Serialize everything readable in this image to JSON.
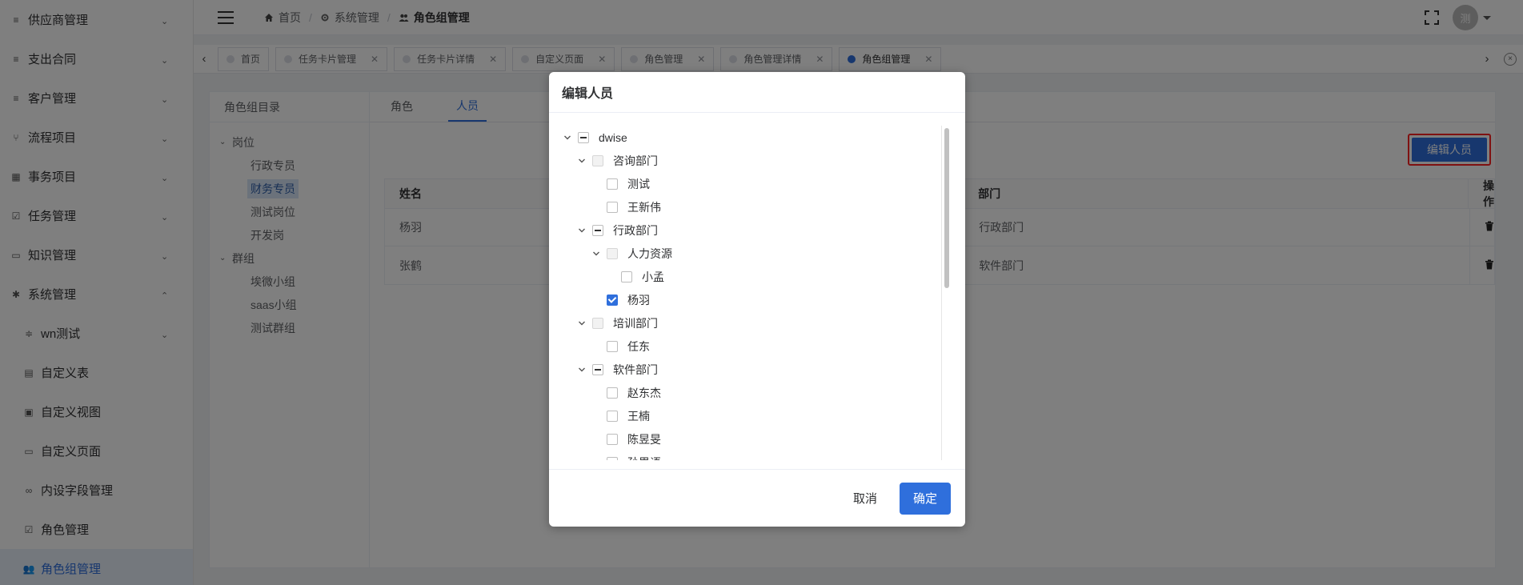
{
  "sidebar": {
    "items": [
      {
        "label": "供应商管理",
        "icon": "list-icon"
      },
      {
        "label": "支出合同",
        "icon": "list-icon"
      },
      {
        "label": "客户管理",
        "icon": "list-icon"
      },
      {
        "label": "流程项目",
        "icon": "branch-icon"
      },
      {
        "label": "事务项目",
        "icon": "grid-icon"
      },
      {
        "label": "任务管理",
        "icon": "checkbox-icon"
      },
      {
        "label": "知识管理",
        "icon": "book-icon"
      },
      {
        "label": "系统管理",
        "icon": "gear-icon"
      }
    ],
    "sub_items": [
      {
        "label": "wn测试",
        "icon": "filter-icon"
      },
      {
        "label": "自定义表",
        "icon": "table-icon"
      },
      {
        "label": "自定义视图",
        "icon": "view-icon"
      },
      {
        "label": "自定义页面",
        "icon": "page-icon"
      },
      {
        "label": "内设字段管理",
        "icon": "link-icon"
      },
      {
        "label": "角色管理",
        "icon": "check-square-icon"
      },
      {
        "label": "角色组管理",
        "icon": "people-icon"
      }
    ]
  },
  "header": {
    "breadcrumb": [
      "首页",
      "系统管理",
      "角色组管理"
    ],
    "avatar_text": "测"
  },
  "tabs": [
    {
      "label": "首页",
      "closable": false,
      "active": false
    },
    {
      "label": "任务卡片管理",
      "closable": true,
      "active": false
    },
    {
      "label": "任务卡片详情",
      "closable": true,
      "active": false
    },
    {
      "label": "自定义页面",
      "closable": true,
      "active": false
    },
    {
      "label": "角色管理",
      "closable": true,
      "active": false
    },
    {
      "label": "角色管理详情",
      "closable": true,
      "active": false
    },
    {
      "label": "角色组管理",
      "closable": true,
      "active": true
    }
  ],
  "left_tree": {
    "title": "角色组目录",
    "groups": [
      {
        "label": "岗位",
        "children": [
          "行政专员",
          "财务专员",
          "测试岗位",
          "开发岗"
        ]
      },
      {
        "label": "群组",
        "children": [
          "埃微小组",
          "saas小组",
          "测试群组"
        ]
      }
    ],
    "selected": "财务专员"
  },
  "right_pane": {
    "tabs": [
      "角色",
      "人员"
    ],
    "active_tab": "人员",
    "edit_button": "编辑人员",
    "table": {
      "headers": [
        "姓名",
        "部门",
        "操作"
      ],
      "rows": [
        {
          "name": "杨羽",
          "dept": "行政部门"
        },
        {
          "name": "张鹤",
          "dept": "软件部门"
        }
      ]
    }
  },
  "dialog": {
    "title": "编辑人员",
    "cancel_label": "取消",
    "ok_label": "确定",
    "tree": [
      {
        "label": "dwise",
        "depth": 0,
        "expand": true,
        "state": "indet"
      },
      {
        "label": "咨询部门",
        "depth": 1,
        "expand": true,
        "state": "disabled"
      },
      {
        "label": "测试",
        "depth": 2,
        "expand": false,
        "state": "none"
      },
      {
        "label": "王新伟",
        "depth": 2,
        "expand": false,
        "state": "none"
      },
      {
        "label": "行政部门",
        "depth": 1,
        "expand": true,
        "state": "indet"
      },
      {
        "label": "人力资源",
        "depth": 2,
        "expand": true,
        "state": "disabled"
      },
      {
        "label": "小孟",
        "depth": 3,
        "expand": false,
        "state": "none"
      },
      {
        "label": "杨羽",
        "depth": 2,
        "expand": false,
        "state": "checked"
      },
      {
        "label": "培训部门",
        "depth": 1,
        "expand": true,
        "state": "disabled"
      },
      {
        "label": "任东",
        "depth": 2,
        "expand": false,
        "state": "none"
      },
      {
        "label": "软件部门",
        "depth": 1,
        "expand": true,
        "state": "indet"
      },
      {
        "label": "赵东杰",
        "depth": 2,
        "expand": false,
        "state": "none"
      },
      {
        "label": "王楠",
        "depth": 2,
        "expand": false,
        "state": "none"
      },
      {
        "label": "陈昱旻",
        "depth": 2,
        "expand": false,
        "state": "none"
      },
      {
        "label": "孙思语",
        "depth": 2,
        "expand": false,
        "state": "none"
      }
    ]
  },
  "colors": {
    "primary": "#2f6fdc",
    "highlight_border": "#f22"
  }
}
